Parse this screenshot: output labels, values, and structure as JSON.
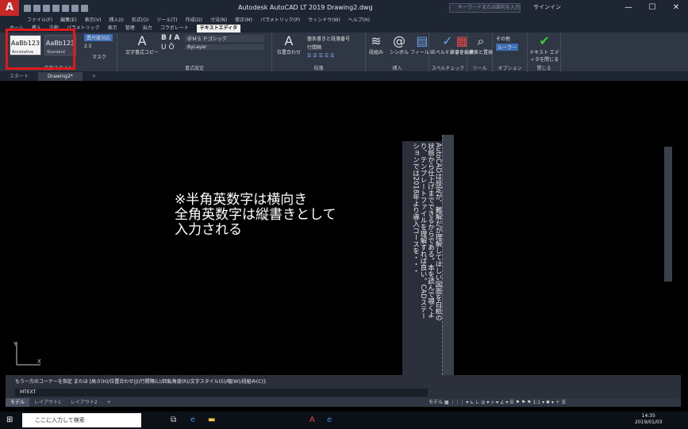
{
  "window": {
    "title": "Autodesk AutoCAD LT 2019   Drawing2.dwg",
    "search_placeholder": "キーワードまたは語句を入力",
    "signin": "サインイン",
    "controls": [
      "—",
      "☐",
      "✕"
    ],
    "app_letter": "A"
  },
  "menu": [
    "ファイル(F)",
    "編集(E)",
    "表示(V)",
    "挿入(I)",
    "形式(O)",
    "ツール(T)",
    "作成(D)",
    "寸法(N)",
    "修正(M)",
    "パラメトリック(P)",
    "ウィンドウ(W)",
    "ヘルプ(H)"
  ],
  "ribbon_tabs": [
    "ホーム",
    "挿入",
    "注釈",
    "パラメトリック",
    "表示",
    "管理",
    "出力",
    "コラボレート",
    "テキストエディタ"
  ],
  "ribbon_active_tab": "テキストエディタ",
  "ribbon": {
    "style_group": "文字スタイル",
    "style1": "AaBb123",
    "style1_cap": "Annotative",
    "style2": "AaBb123",
    "style2_cap": "Standard",
    "annotative_btn": "異尺度対応",
    "height_value": "2.5",
    "mask": "マスク",
    "format_group": "書式設定",
    "match": "文字書式コピー",
    "font": "＠ＭＳ Ｐゴシック",
    "color": "ByLayer",
    "paragraph_group": "段落",
    "justify": "位置合わせ",
    "bullets": "箇条書きと段落番号",
    "line_spacing": "行間隔",
    "insert_group": "挿入",
    "columns": "段組み",
    "symbol": "シンボル",
    "field": "フィールド",
    "spell_group": "スペルチェック",
    "spell": "スペルチェック",
    "dict": "辞書を編集",
    "tools_group": "ツール",
    "find": "検索と置換",
    "options_group": "オプション",
    "more": "その他",
    "ruler": "ルーラー",
    "close_group": "閉じる",
    "close_editor": "テキスト エディタを閉じる"
  },
  "doc_tabs": [
    "スタート",
    "Drawing2*",
    "+"
  ],
  "canvas": {
    "mtext_lines": [
      "※半角英数字は横向き",
      "全角英数字は縦書きとして",
      "入力される"
    ],
    "vertical_text": "AutoCADは設定が、難解だが理解してほしい図面を白紙の状態から仕上げまでできるからである。本を読んで覗くより、テンプレートファイルを理解すれば良い。CADステーションでは2018年より導入コースを・・・",
    "axis_y": "Y",
    "axis_x": "X"
  },
  "command": {
    "prompt": "もう一方のコーナーを指定 または [高さ(H)/位置合わせ(J)/行間隔(L)/回転角度(R)/文字スタイル(S)/幅(W)/段組み(C)]:",
    "input": "MTEXT"
  },
  "layout_tabs": [
    "モデル",
    "レイアウト1",
    "レイアウト2",
    "+"
  ],
  "status_right": "モデル  ▦ ⋮⋮⋮ ▾ ⊾ ∟ ◎ ▾ ⊹ ▾ ∠ ▾ ☰ ⚑ ⚑ ⚑ 1:1 ▾ ✱ ▾ ＋ ☰",
  "taskbar": {
    "search": "ここに入力して検索",
    "time": "14:35",
    "date": "2019/01/03"
  }
}
